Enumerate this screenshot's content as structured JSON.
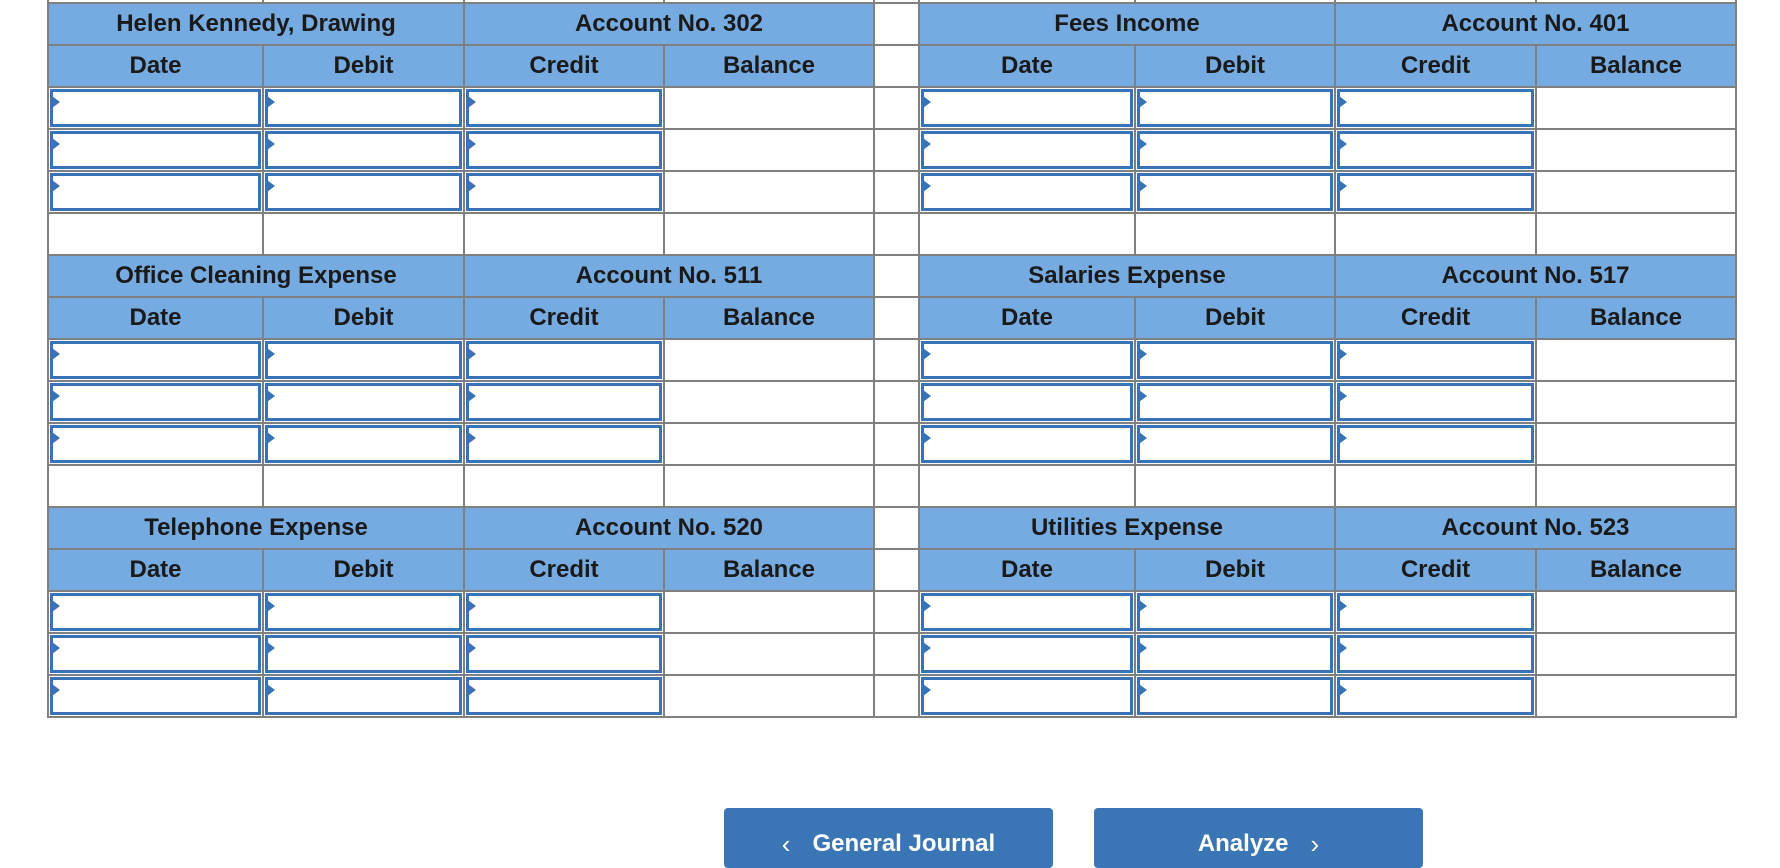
{
  "blocks": [
    {
      "left": {
        "title": "Helen Kennedy, Drawing",
        "account": "Account No. 302"
      },
      "right": {
        "title": "Fees Income",
        "account": "Account No. 401"
      },
      "input_rows": 3,
      "blank_rows": 1
    },
    {
      "left": {
        "title": "Office Cleaning Expense",
        "account": "Account No. 511"
      },
      "right": {
        "title": "Salaries Expense",
        "account": "Account No. 517"
      },
      "input_rows": 3,
      "blank_rows": 1
    },
    {
      "left": {
        "title": "Telephone Expense",
        "account": "Account No. 520"
      },
      "right": {
        "title": "Utilities Expense",
        "account": "Account No. 523"
      },
      "input_rows": 3,
      "blank_rows": 0
    }
  ],
  "columns": [
    "Date",
    "Debit",
    "Credit",
    "Balance"
  ],
  "buttons": {
    "prev": "General Journal",
    "next": "Analyze",
    "prev_icon": "chevron-left-icon",
    "next_icon": "chevron-right-icon"
  },
  "colors": {
    "header": "#76abe1",
    "input_border": "#3a73b5",
    "button": "#3a76b5",
    "grid": "#808080"
  }
}
